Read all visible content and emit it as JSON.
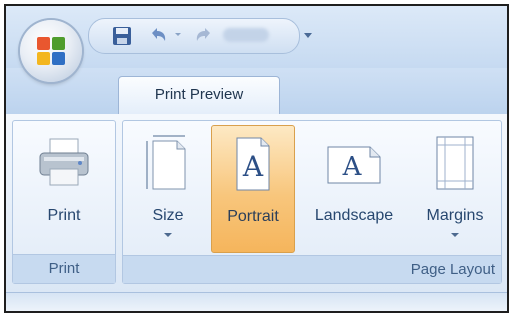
{
  "window": {
    "title": "",
    "office_button_icon": "office-logo-icon"
  },
  "quick_access": {
    "items": [
      "save-icon",
      "undo-icon",
      "redo-icon",
      "customize-dropdown-icon"
    ]
  },
  "tabs": [
    {
      "label": "Print Preview",
      "active": true
    }
  ],
  "groups": {
    "print": {
      "label": "Print",
      "buttons": [
        {
          "label": "Print",
          "icon": "printer-icon"
        }
      ]
    },
    "page_layout": {
      "label": "Page Layout",
      "buttons": [
        {
          "label": "Size",
          "icon": "page-size-icon",
          "dropdown": true
        },
        {
          "label": "Portrait",
          "icon": "portrait-icon",
          "selected": true
        },
        {
          "label": "Landscape",
          "icon": "landscape-icon"
        },
        {
          "label": "Margins",
          "icon": "margins-icon",
          "dropdown": true
        }
      ]
    }
  },
  "colors": {
    "accent_selected": "#f8c67c",
    "ribbon_bg": "#dbe7f5",
    "label_text": "#27476f"
  }
}
